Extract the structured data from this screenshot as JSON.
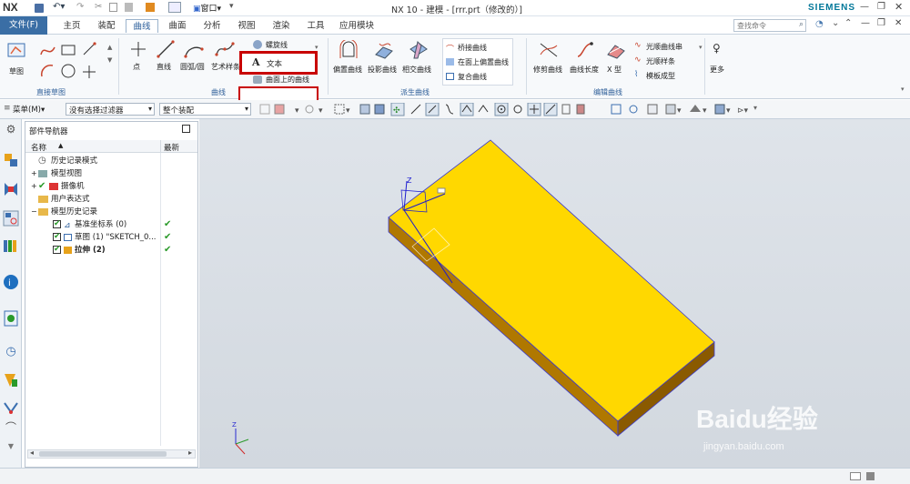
{
  "title": {
    "app_logo": "NX",
    "window_menu": "窗口",
    "window_title": "NX 10 - 建模 - [rrr.prt（修改的）]",
    "brand": "SIEMENS"
  },
  "menubar": {
    "file": "文件(F)",
    "tabs": [
      "主页",
      "装配",
      "曲线",
      "曲面",
      "分析",
      "视图",
      "渲染",
      "工具",
      "应用模块"
    ],
    "active_tab": "曲线",
    "search_placeholder": "查找命令"
  },
  "ribbon": {
    "groups": {
      "direct_sketch": "直接草图",
      "curve": "曲线",
      "derived": "派生曲线",
      "edit": "编辑曲线"
    },
    "sketch": "草图",
    "point": "点",
    "line": "直线",
    "arc": "圆弧/圆",
    "art_spline": "艺术样条",
    "helix": "螺旋线",
    "text": "文本",
    "surface_curve": "曲面上的曲线",
    "offset_curve": "偏置曲线",
    "projection_curve": "投影曲线",
    "intersect_curve": "相交曲线",
    "bridge_curve": "桥接曲线",
    "offset_on_face": "在面上偏置曲线",
    "composite_curve": "复合曲线",
    "trim_curve": "修剪曲线",
    "curve_length": "曲线长度",
    "x_form": "X 型",
    "smooth_curve_chain": "光顺曲线串",
    "smooth_spline": "光顺样条",
    "template_forming": "模板成型",
    "more": "更多"
  },
  "toolbar2": {
    "menu": "菜单(M)",
    "filter": "没有选择过滤器",
    "assembly": "整个装配"
  },
  "navigator": {
    "title": "部件导航器",
    "col_name": "名称",
    "col_latest": "最新",
    "rows": [
      {
        "label": "历史记录模式"
      },
      {
        "label": "模型视图"
      },
      {
        "label": "摄像机"
      },
      {
        "label": "用户表达式"
      },
      {
        "label": "模型历史记录"
      },
      {
        "label": "基准坐标系 (0)"
      },
      {
        "label": "草图 (1) \"SKETCH_0..."
      },
      {
        "label": "拉伸 (2)"
      }
    ]
  },
  "watermark": {
    "brand": "Baidu经验",
    "url": "jingyan.baidu.com"
  },
  "colors": {
    "accent": "#2a5d9a",
    "highlight_box": "#c80000",
    "block_top": "#ffd800",
    "block_side": "#b07800",
    "viewport_bg": "#d8dde3"
  }
}
